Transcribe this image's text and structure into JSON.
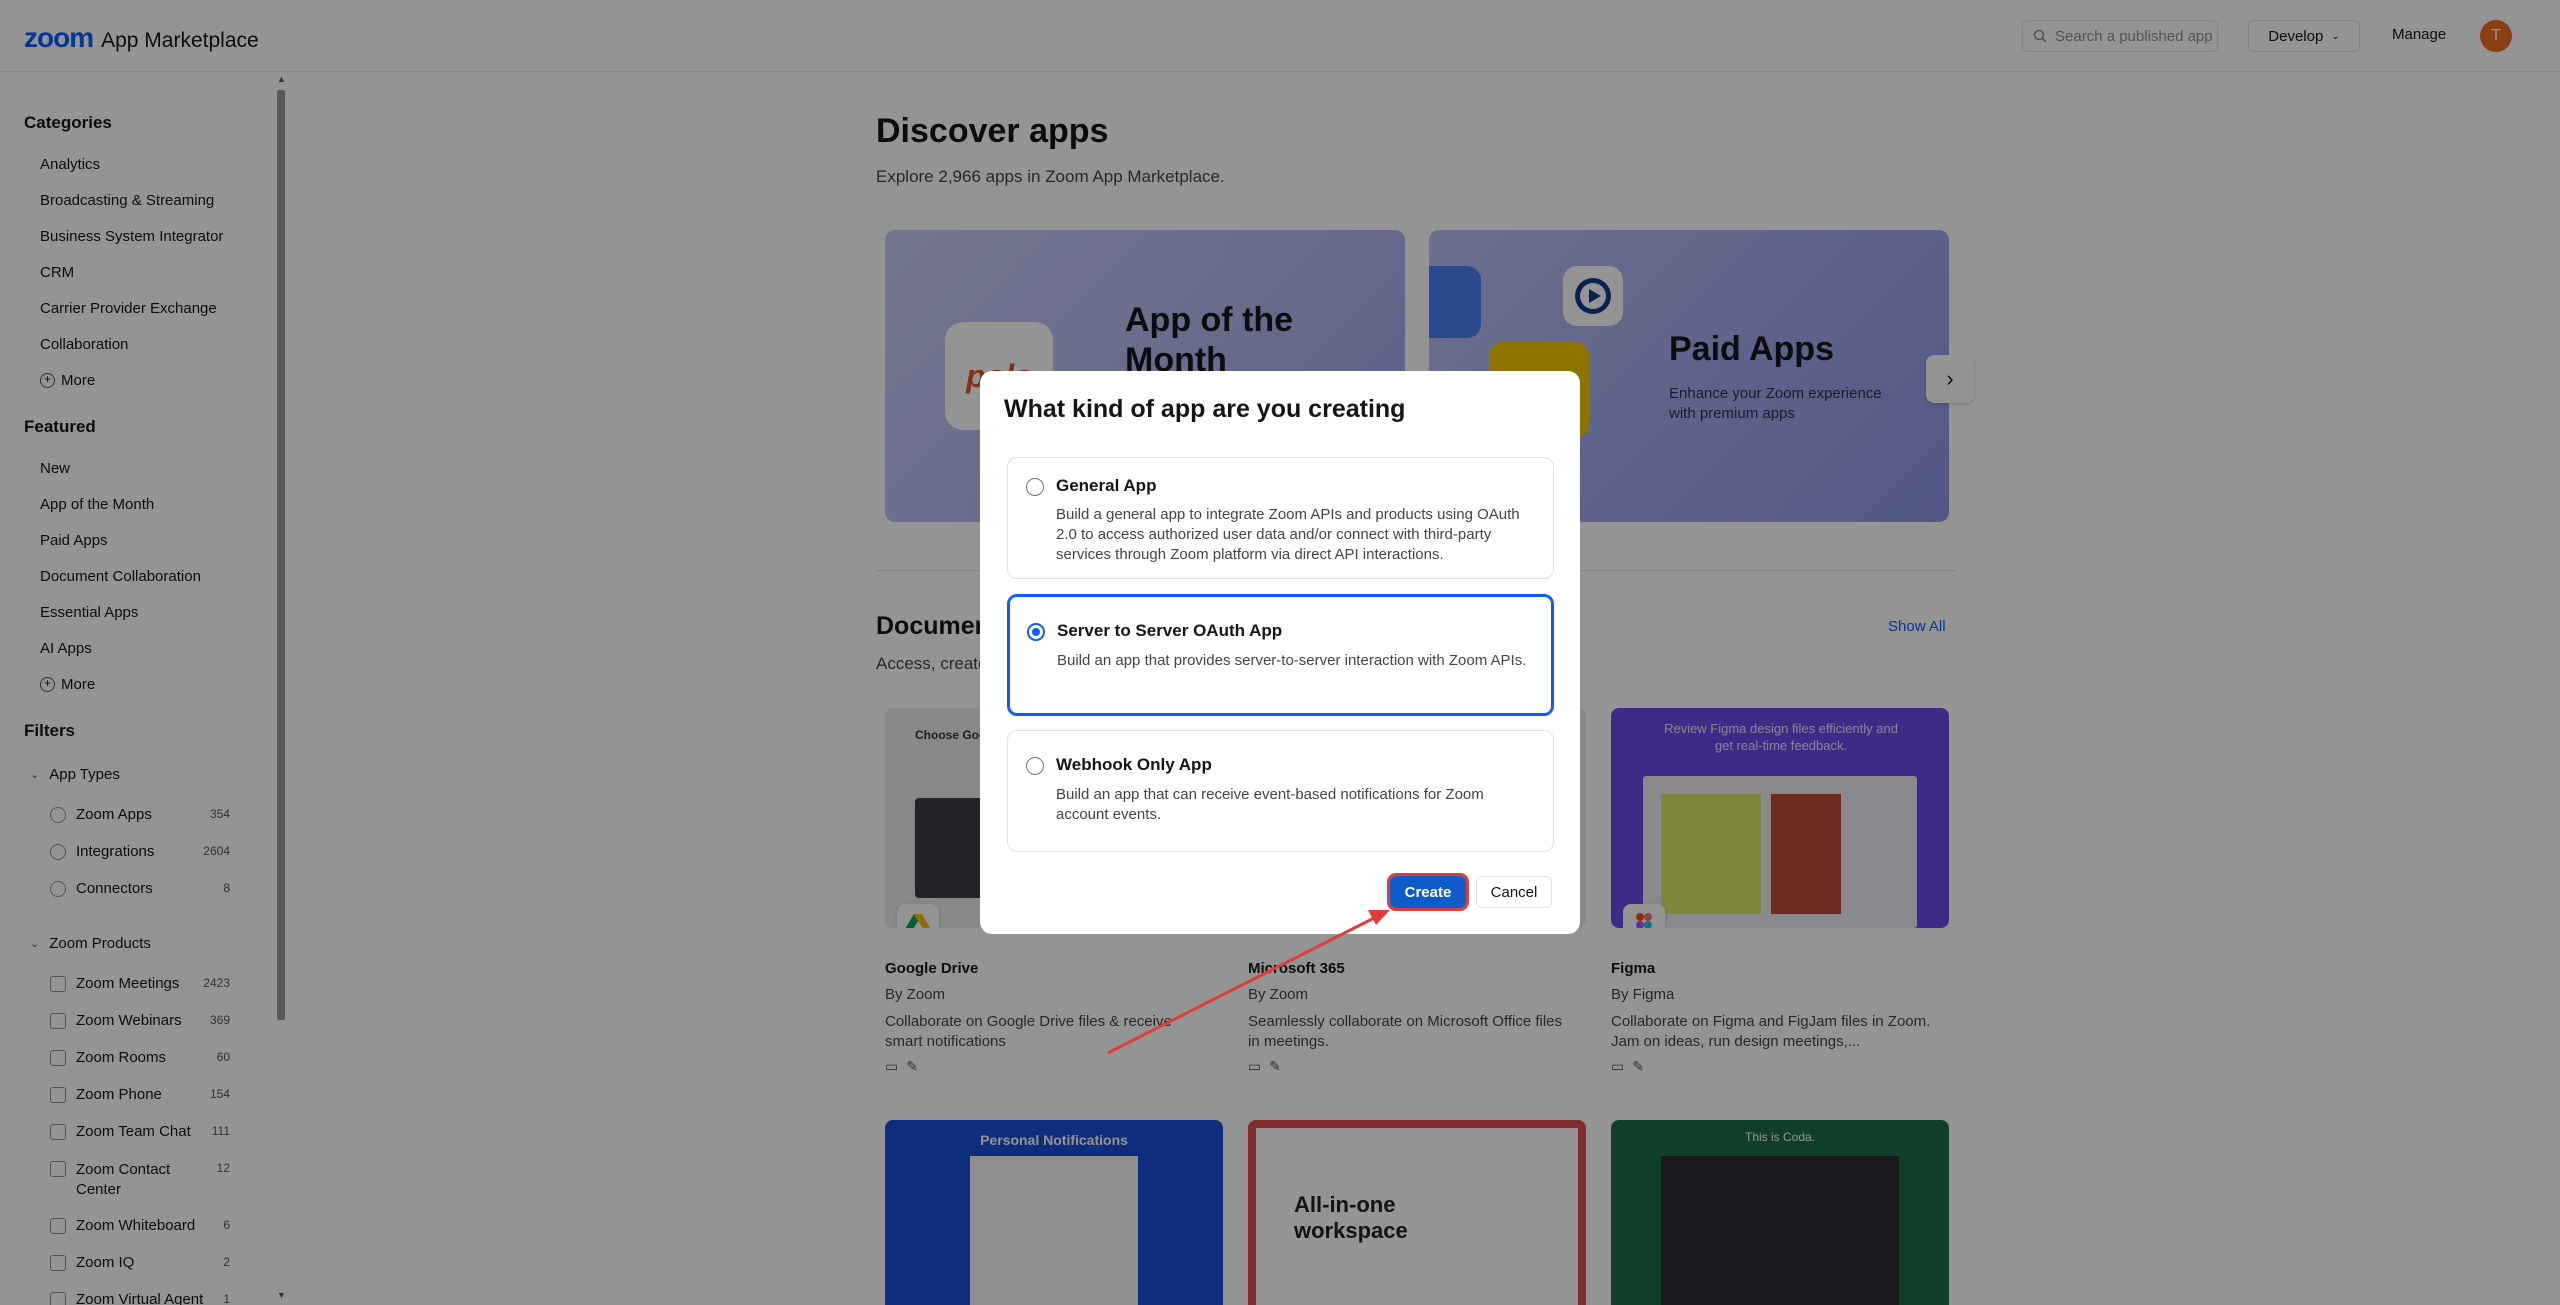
{
  "header": {
    "logo_zoom": "zoom",
    "logo_text": "App Marketplace",
    "search_placeholder": "Search a published app",
    "develop_label": "Develop",
    "manage_label": "Manage",
    "avatar_letter": "T"
  },
  "sidebar": {
    "categories_heading": "Categories",
    "categories": [
      "Analytics",
      "Broadcasting & Streaming",
      "Business System Integrator",
      "CRM",
      "Carrier Provider Exchange",
      "Collaboration"
    ],
    "categories_more": "More",
    "featured_heading": "Featured",
    "featured": [
      "New",
      "App of the Month",
      "Paid Apps",
      "Document Collaboration",
      "Essential Apps",
      "AI Apps"
    ],
    "featured_more": "More",
    "filters_heading": "Filters",
    "app_types_label": "App Types",
    "app_types": [
      {
        "label": "Zoom Apps",
        "count": "354"
      },
      {
        "label": "Integrations",
        "count": "2604"
      },
      {
        "label": "Connectors",
        "count": "8"
      }
    ],
    "zoom_products_label": "Zoom Products",
    "zoom_products": [
      {
        "label": "Zoom Meetings",
        "count": "2423"
      },
      {
        "label": "Zoom Webinars",
        "count": "369"
      },
      {
        "label": "Zoom Rooms",
        "count": "60"
      },
      {
        "label": "Zoom Phone",
        "count": "154"
      },
      {
        "label": "Zoom Team Chat",
        "count": "111"
      },
      {
        "label": "Zoom Contact Center",
        "count": "12"
      },
      {
        "label": "Zoom Whiteboard",
        "count": "6"
      },
      {
        "label": "Zoom IQ",
        "count": "2"
      },
      {
        "label": "Zoom Virtual Agent",
        "count": "1"
      }
    ]
  },
  "main": {
    "title": "Discover apps",
    "subtitle": "Explore 2,966 apps in Zoom App Marketplace.",
    "banner1_title": "App of the Month",
    "banner1_logo": "pole",
    "banner2_title": "Paid Apps",
    "banner2_sub": "Enhance your Zoom experience with premium apps",
    "section_title": "Document Collaboration",
    "section_sub": "Access, create, and share documents in Zoom.",
    "show_all": "Show All",
    "cards": [
      {
        "name": "Google Drive",
        "by": "By Zoom",
        "desc": "Collaborate on Google Drive files & receive smart notifications",
        "thumb_text": "Choose Goo..."
      },
      {
        "name": "Microsoft 365",
        "by": "By Zoom",
        "desc": "Seamlessly collaborate on Microsoft Office files in meetings.",
        "thumb_text": ""
      },
      {
        "name": "Figma",
        "by": "By Figma",
        "desc": "Collaborate on Figma and FigJam files in Zoom. Jam on ideas, run design meetings,...",
        "thumb_text": "Review Figma design files efficiently and get real-time feedback."
      }
    ],
    "cards_row2": [
      {
        "thumb_text": "Personal Notifications"
      },
      {
        "thumb_text": "All-in-one workspace"
      },
      {
        "thumb_text": "This is Coda."
      }
    ]
  },
  "modal": {
    "title": "What kind of app are you creating",
    "options": [
      {
        "title": "General App",
        "desc": "Build a general app to integrate Zoom APIs and products using OAuth 2.0 to access authorized user data and/or connect with third-party services through Zoom platform via direct API interactions.",
        "selected": false
      },
      {
        "title": "Server to Server OAuth App",
        "desc": "Build an app that provides server-to-server interaction with Zoom APIs.",
        "selected": true
      },
      {
        "title": "Webhook Only App",
        "desc": "Build an app that can receive event-based notifications for Zoom account events.",
        "selected": false
      }
    ],
    "create_label": "Create",
    "cancel_label": "Cancel"
  },
  "colors": {
    "brand": "#0b5cff",
    "create_button": "#0e5cc9",
    "annotation_red": "#e23b3b",
    "avatar": "#f26d21"
  }
}
